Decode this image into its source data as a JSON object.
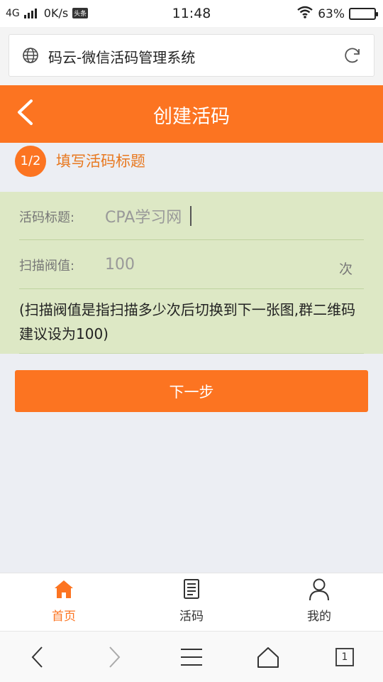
{
  "status_bar": {
    "network": "4G",
    "speed": "0K/s",
    "speed_badge": "头条",
    "time": "11:48",
    "battery": "63%",
    "battery_level": 0.63
  },
  "browser": {
    "page_title": "码云-微信活码管理系统"
  },
  "header": {
    "title": "创建活码"
  },
  "step": {
    "badge": "1/2",
    "label": "填写活码标题"
  },
  "form": {
    "title_label": "活码标题:",
    "title_value": "CPA学习网",
    "threshold_label": "扫描阀值:",
    "threshold_value": "100",
    "threshold_unit": "次",
    "hint": "(扫描阀值是指扫描多少次后切换到下一张图,群二维码建议设为100)"
  },
  "actions": {
    "next_label": "下一步"
  },
  "tabbar": {
    "items": [
      {
        "label": "首页",
        "icon": "home-icon",
        "active": true
      },
      {
        "label": "活码",
        "icon": "document-icon",
        "active": false
      },
      {
        "label": "我的",
        "icon": "user-icon",
        "active": false
      }
    ]
  },
  "browser_nav": {
    "tab_count": "1"
  },
  "colors": {
    "accent": "#fc7421",
    "form_bg": "#dde8c5",
    "page_bg": "#eceef3"
  }
}
